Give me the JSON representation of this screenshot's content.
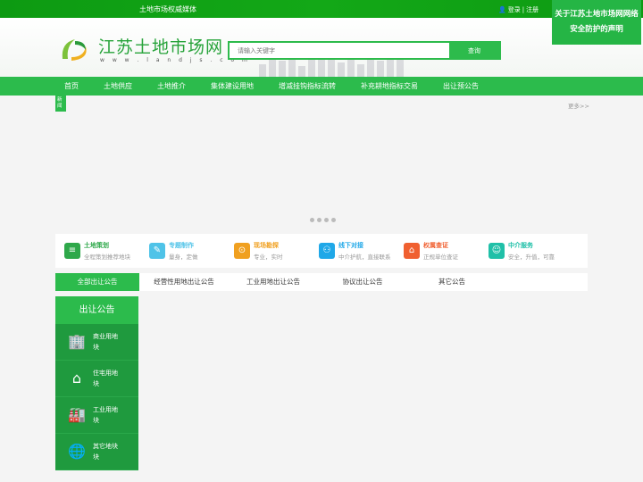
{
  "topbar": {
    "slogan": "土地市场权威媒体",
    "login": "登录",
    "separator": "|",
    "register": "注册"
  },
  "notice": {
    "line1": "关于江苏土地市场网网络",
    "line2": "安全防护的声明"
  },
  "header": {
    "site_title": "江苏土地市场网",
    "site_url": "w w w . l a n d j s . c o m",
    "search_placeholder": "请输入关键字",
    "search_button": "查询"
  },
  "nav": {
    "items": [
      "首页",
      "土地供应",
      "土地推介",
      "集体建设用地",
      "增减挂钩指标流转",
      "补充耕地指标交易",
      "出让预公告"
    ]
  },
  "news": {
    "tag": "新闻",
    "more": "更多>>"
  },
  "services": [
    {
      "title": "土地策划",
      "desc": "全程策划推荐地块",
      "color": "#2ea84a",
      "icon": "document-icon"
    },
    {
      "title": "专题制作",
      "desc": "量身，定做",
      "color": "#4fc3e8",
      "icon": "pencil-icon"
    },
    {
      "title": "现场勘探",
      "desc": "专业，实时",
      "color": "#f0a020",
      "icon": "location-icon"
    },
    {
      "title": "线下对接",
      "desc": "中介护航，直接联系",
      "color": "#20a8e8",
      "icon": "people-icon"
    },
    {
      "title": "权属查证",
      "desc": "正规单位查证",
      "color": "#f06030",
      "icon": "stamp-icon"
    },
    {
      "title": "中介服务",
      "desc": "安全，升值，可靠",
      "color": "#20c0a8",
      "icon": "person-icon"
    }
  ],
  "tabs": [
    "全部出让公告",
    "经营性用地出让公告",
    "工业用地出让公告",
    "协议出让公告",
    "其它公告"
  ],
  "sidebar": {
    "title": "出让公告",
    "items": [
      {
        "label": "商业用地块",
        "icon": "buildings-icon"
      },
      {
        "label": "住宅用地块",
        "icon": "house-icon"
      },
      {
        "label": "工业用地块",
        "icon": "factory-icon"
      },
      {
        "label": "其它地块块",
        "icon": "globe-icon"
      }
    ]
  }
}
